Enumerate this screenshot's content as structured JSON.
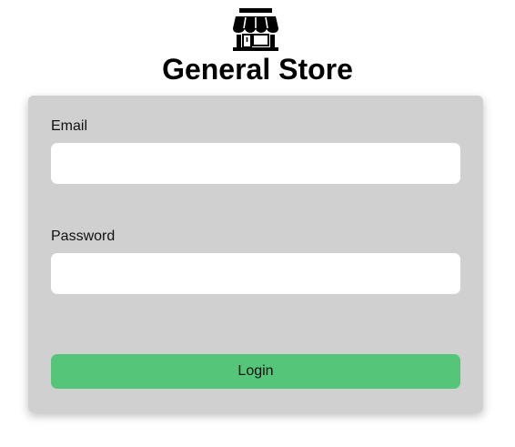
{
  "header": {
    "logo_icon": "store-icon",
    "title": "General Store"
  },
  "form": {
    "email": {
      "label": "Email",
      "value": "",
      "placeholder": ""
    },
    "password": {
      "label": "Password",
      "value": "",
      "placeholder": ""
    },
    "login_label": "Login"
  },
  "colors": {
    "card_background": "#d0d0d0",
    "button_background": "#55c57a",
    "input_background": "#ffffff"
  }
}
